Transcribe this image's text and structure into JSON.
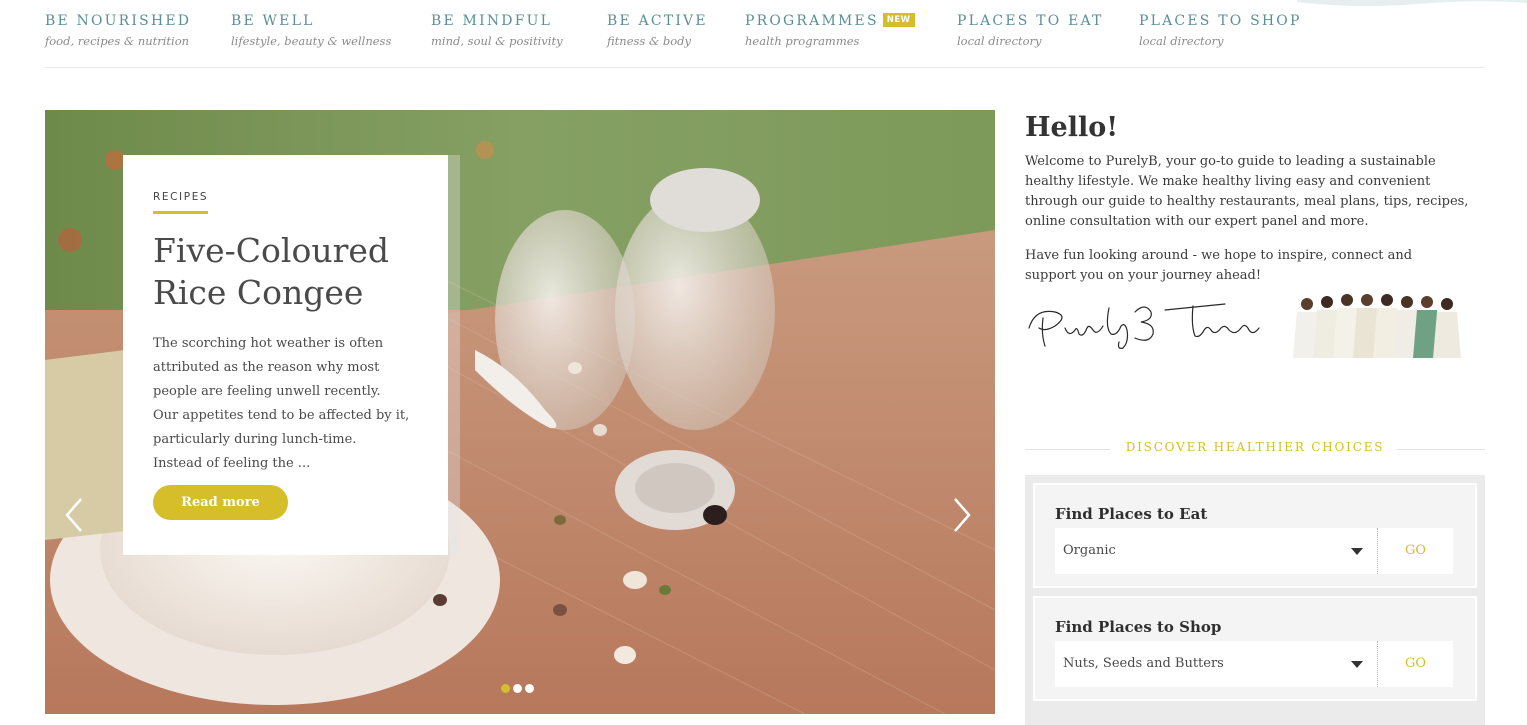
{
  "nav": {
    "items": [
      {
        "title": "BE NOURISHED",
        "sub": "food, recipes & nutrition"
      },
      {
        "title": "BE WELL",
        "sub": "lifestyle, beauty & wellness"
      },
      {
        "title": "BE MINDFUL",
        "sub": "mind, soul & positivity"
      },
      {
        "title": "BE ACTIVE",
        "sub": "fitness & body"
      },
      {
        "title": "PROGRAMMES",
        "sub": "health programmes",
        "badge": "NEW"
      },
      {
        "title": "PLACES TO EAT",
        "sub": "local directory"
      },
      {
        "title": "PLACES TO SHOP",
        "sub": "local directory"
      }
    ]
  },
  "slider": {
    "card": {
      "tag": "RECIPES",
      "title_line1": "Five-Coloured",
      "title_line2": "Rice Congee",
      "body_lines": [
        "The scorching hot weather is often",
        "attributed as the reason why most",
        "people are feeling unwell recently.",
        "Our appetites tend to be affected by it,",
        "particularly during lunch-time.",
        "Instead of feeling the ..."
      ],
      "button": "Read more"
    },
    "icons": {
      "prev": "chevron-left-icon",
      "next": "chevron-right-icon"
    },
    "dots_count": 3,
    "active_dot": 1
  },
  "welcome": {
    "heading": "Hello!",
    "paragraph1_lines": [
      "Welcome to PurelyB, your go-to guide to leading a sustainable",
      "healthy lifestyle. We make healthy living easy and convenient",
      "through our guide to healthy restaurants, meal plans, tips, recipes,",
      "online consultation with our expert panel and more."
    ],
    "paragraph2_lines": [
      "Have fun looking around - we hope to inspire, connect and",
      "support you on your journey ahead!"
    ],
    "signature": "PurelyB Team"
  },
  "discover": {
    "heading": "DISCOVER HEALTHIER CHOICES",
    "eat": {
      "label": "Find Places to Eat",
      "selected": "Organic",
      "go": "GO"
    },
    "shop": {
      "label": "Find Places to Shop",
      "selected": "Nuts, Seeds and Butters",
      "go": "GO"
    }
  },
  "colors": {
    "accent": "#d6bd2a",
    "nav_teal": "#5a8f97"
  }
}
